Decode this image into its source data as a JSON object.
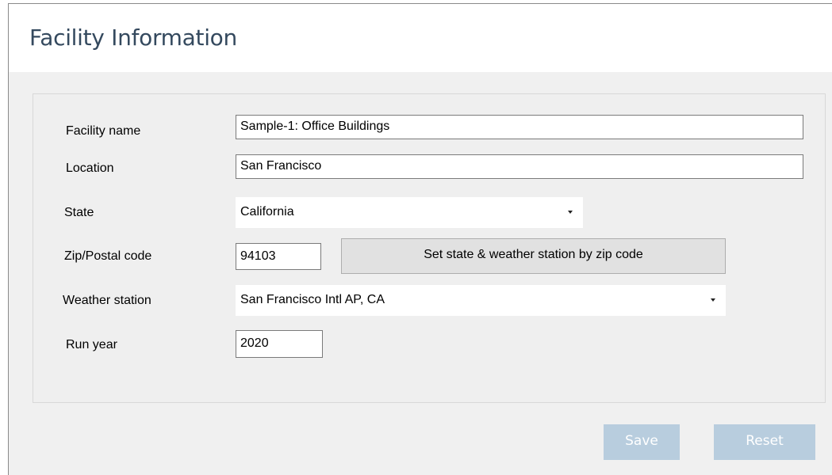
{
  "header": {
    "title": "Facility Information"
  },
  "form": {
    "facility_name": {
      "label": "Facility name",
      "value": "Sample-1:  Office Buildings"
    },
    "location": {
      "label": "Location",
      "value": "San Francisco"
    },
    "state": {
      "label": "State",
      "value": "California"
    },
    "zip": {
      "label": "Zip/Postal code",
      "value": "94103"
    },
    "zip_button": {
      "label": "Set state & weather station by zip code"
    },
    "weather_station": {
      "label": "Weather station",
      "value": "San Francisco Intl AP, CA"
    },
    "run_year": {
      "label": "Run year",
      "value": "2020"
    }
  },
  "actions": {
    "save_label": "Save",
    "reset_label": "Reset",
    "disabled_color": "#b8cdde"
  },
  "icons": {
    "dropdown": "chevron-down-icon"
  }
}
